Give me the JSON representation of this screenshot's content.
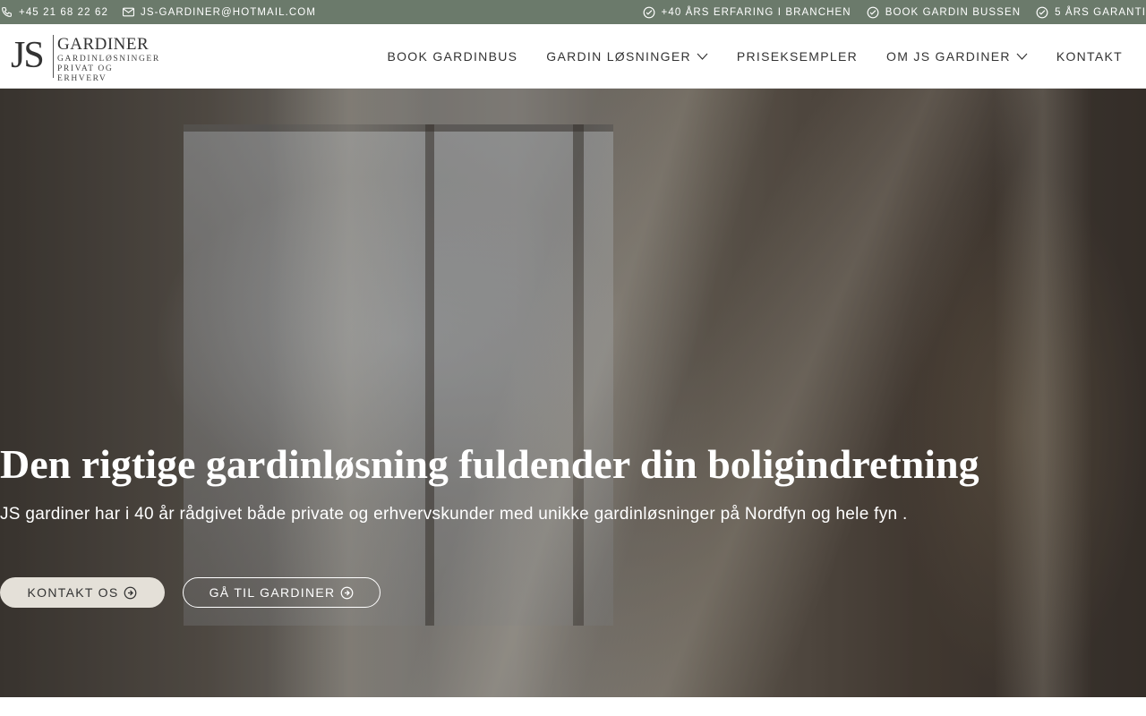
{
  "topbar": {
    "phone": "+45 21 68 22 62",
    "email": "JS-GARDINER@HOTMAIL.COM",
    "badges": [
      "+40 ÅRS ERFARING I BRANCHEN",
      "BOOK GARDIN BUSSEN",
      "5 ÅRS GARANTI"
    ]
  },
  "logo": {
    "mark": "JS",
    "name": "GARDINER",
    "tagline_1": "GARDINLØSNINGER",
    "tagline_2": "PRIVAT OG ERHVERV"
  },
  "nav": {
    "items": [
      {
        "label": "BOOK GARDINBUS",
        "has_dropdown": false
      },
      {
        "label": "GARDIN LØSNINGER",
        "has_dropdown": true
      },
      {
        "label": "PRISEKSEMPLER",
        "has_dropdown": false
      },
      {
        "label": "OM JS GARDINER",
        "has_dropdown": true
      },
      {
        "label": "KONTAKT",
        "has_dropdown": false
      }
    ]
  },
  "hero": {
    "title": "Den rigtige gardinløsning fuldender din boligindretning",
    "subtitle": "JS gardiner har i 40 år rådgivet både private og erhvervskunder med unikke gardinløsninger på Nordfyn og hele fyn .",
    "primary_button": "KONTAKT OS",
    "secondary_button": "GÅ TIL GARDINER"
  },
  "colors": {
    "topbar_bg": "#6b7a6b",
    "header_bg": "#ffffff",
    "primary_button_bg": "#e4e0d8",
    "text_dark": "#333333"
  },
  "icons": {
    "phone": "phone-icon",
    "email": "envelope-icon",
    "badge": "check-circle-icon",
    "dropdown": "chevron-down-icon",
    "button_arrow": "arrow-circle-right-icon"
  }
}
